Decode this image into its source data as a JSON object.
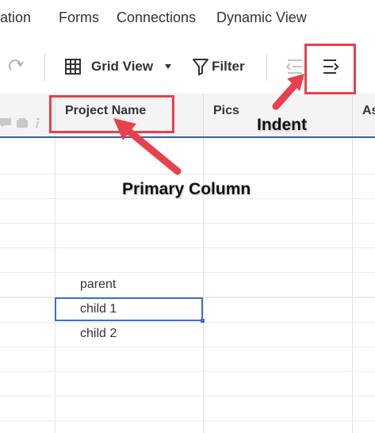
{
  "menu": {
    "items": [
      "ation",
      "Forms",
      "Connections",
      "Dynamic View"
    ]
  },
  "toolbar": {
    "view_label": "Grid View",
    "filter_label": "Filter"
  },
  "grid": {
    "columns": [
      "Project Name",
      "Pics",
      "As"
    ],
    "rows": [
      "parent",
      "child 1",
      "child 2"
    ],
    "selected_row": "child 1"
  },
  "annotations": {
    "indent_label": "Indent",
    "primary_column_label": "Primary Column",
    "color": "#e8414b"
  },
  "colors": {
    "accent": "#3c5aa6",
    "selection": "#3c6fd1",
    "header_bg": "#f4f4f4"
  },
  "icons": [
    "redo-icon",
    "grid-view-icon",
    "dropdown-caret-icon",
    "filter-icon",
    "outdent-icon",
    "indent-icon",
    "comment-icon",
    "attachment-icon",
    "info-icon"
  ]
}
